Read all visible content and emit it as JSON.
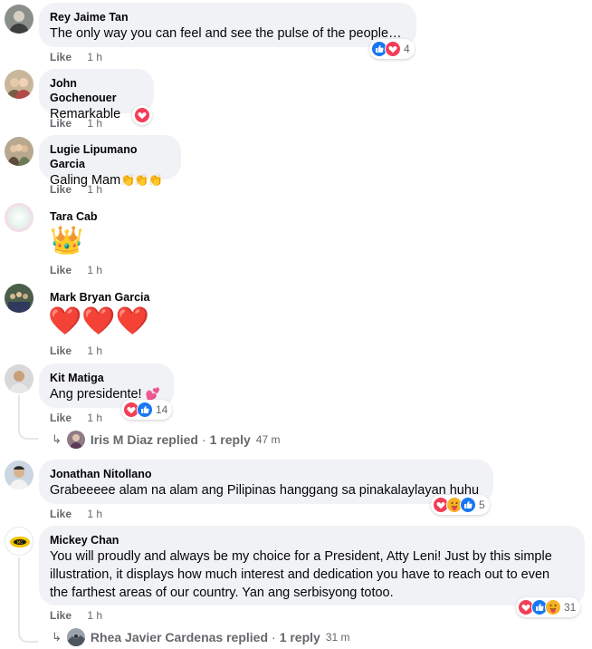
{
  "comments": [
    {
      "author": "Rey Jaime Tan",
      "text": "The only way you can feel and see the pulse of the people…",
      "like": "Like",
      "time": "1 h",
      "reaction_count": "4"
    },
    {
      "author": "John Gochenouer",
      "text": "Remarkable",
      "like": "Like",
      "time": "1 h"
    },
    {
      "author": "Lugie Lipumano Garcia",
      "text": "Galing Mam",
      "emoji": "👏👏👏",
      "like": "Like",
      "time": "1 h"
    },
    {
      "author": "Tara Cab",
      "emoji": "👑",
      "like": "Like",
      "time": "1 h"
    },
    {
      "author": "Mark Bryan Garcia",
      "emoji": "❤️❤️❤️",
      "like": "Like",
      "time": "1 h"
    },
    {
      "author": "Kit Matiga",
      "text": "Ang presidente!",
      "emoji": "💕",
      "like": "Like",
      "time": "1 h",
      "reaction_count": "14",
      "reply": {
        "author_action": "Iris M Diaz replied",
        "separator": "·",
        "count": "1 reply",
        "time": "47 m"
      }
    },
    {
      "author": "Jonathan Nitollano",
      "text": "Grabeeeee alam na alam ang Pilipinas hanggang sa pinakalaylayan huhu",
      "like": "Like",
      "time": "1 h",
      "reaction_count": "5"
    },
    {
      "author": "Mickey Chan",
      "text_lines": [
        "You will proudly and always be my choice for a President, Atty Leni! Just by this simple",
        "illustration, it displays how much interest and dedication you have to reach out to even",
        "the farthest areas of our country. Yan ang serbisyong totoo."
      ],
      "like": "Like",
      "time": "1 h",
      "reaction_count": "31",
      "reply": {
        "author_action": "Rhea Javier Cardenas replied",
        "separator": "·",
        "count": "1 reply",
        "time": "31 m"
      }
    }
  ],
  "icons": {
    "like": "like-reaction-icon",
    "love": "love-reaction-icon",
    "care": "care-reaction-icon",
    "reply_arrow": "reply-arrow-icon"
  },
  "colors": {
    "like_blue": "#1877f2",
    "love_red": "#f33e58",
    "care_yellow": "#f7b125",
    "bubble_bg": "#f0f2f5",
    "meta_gray": "#65676b"
  }
}
